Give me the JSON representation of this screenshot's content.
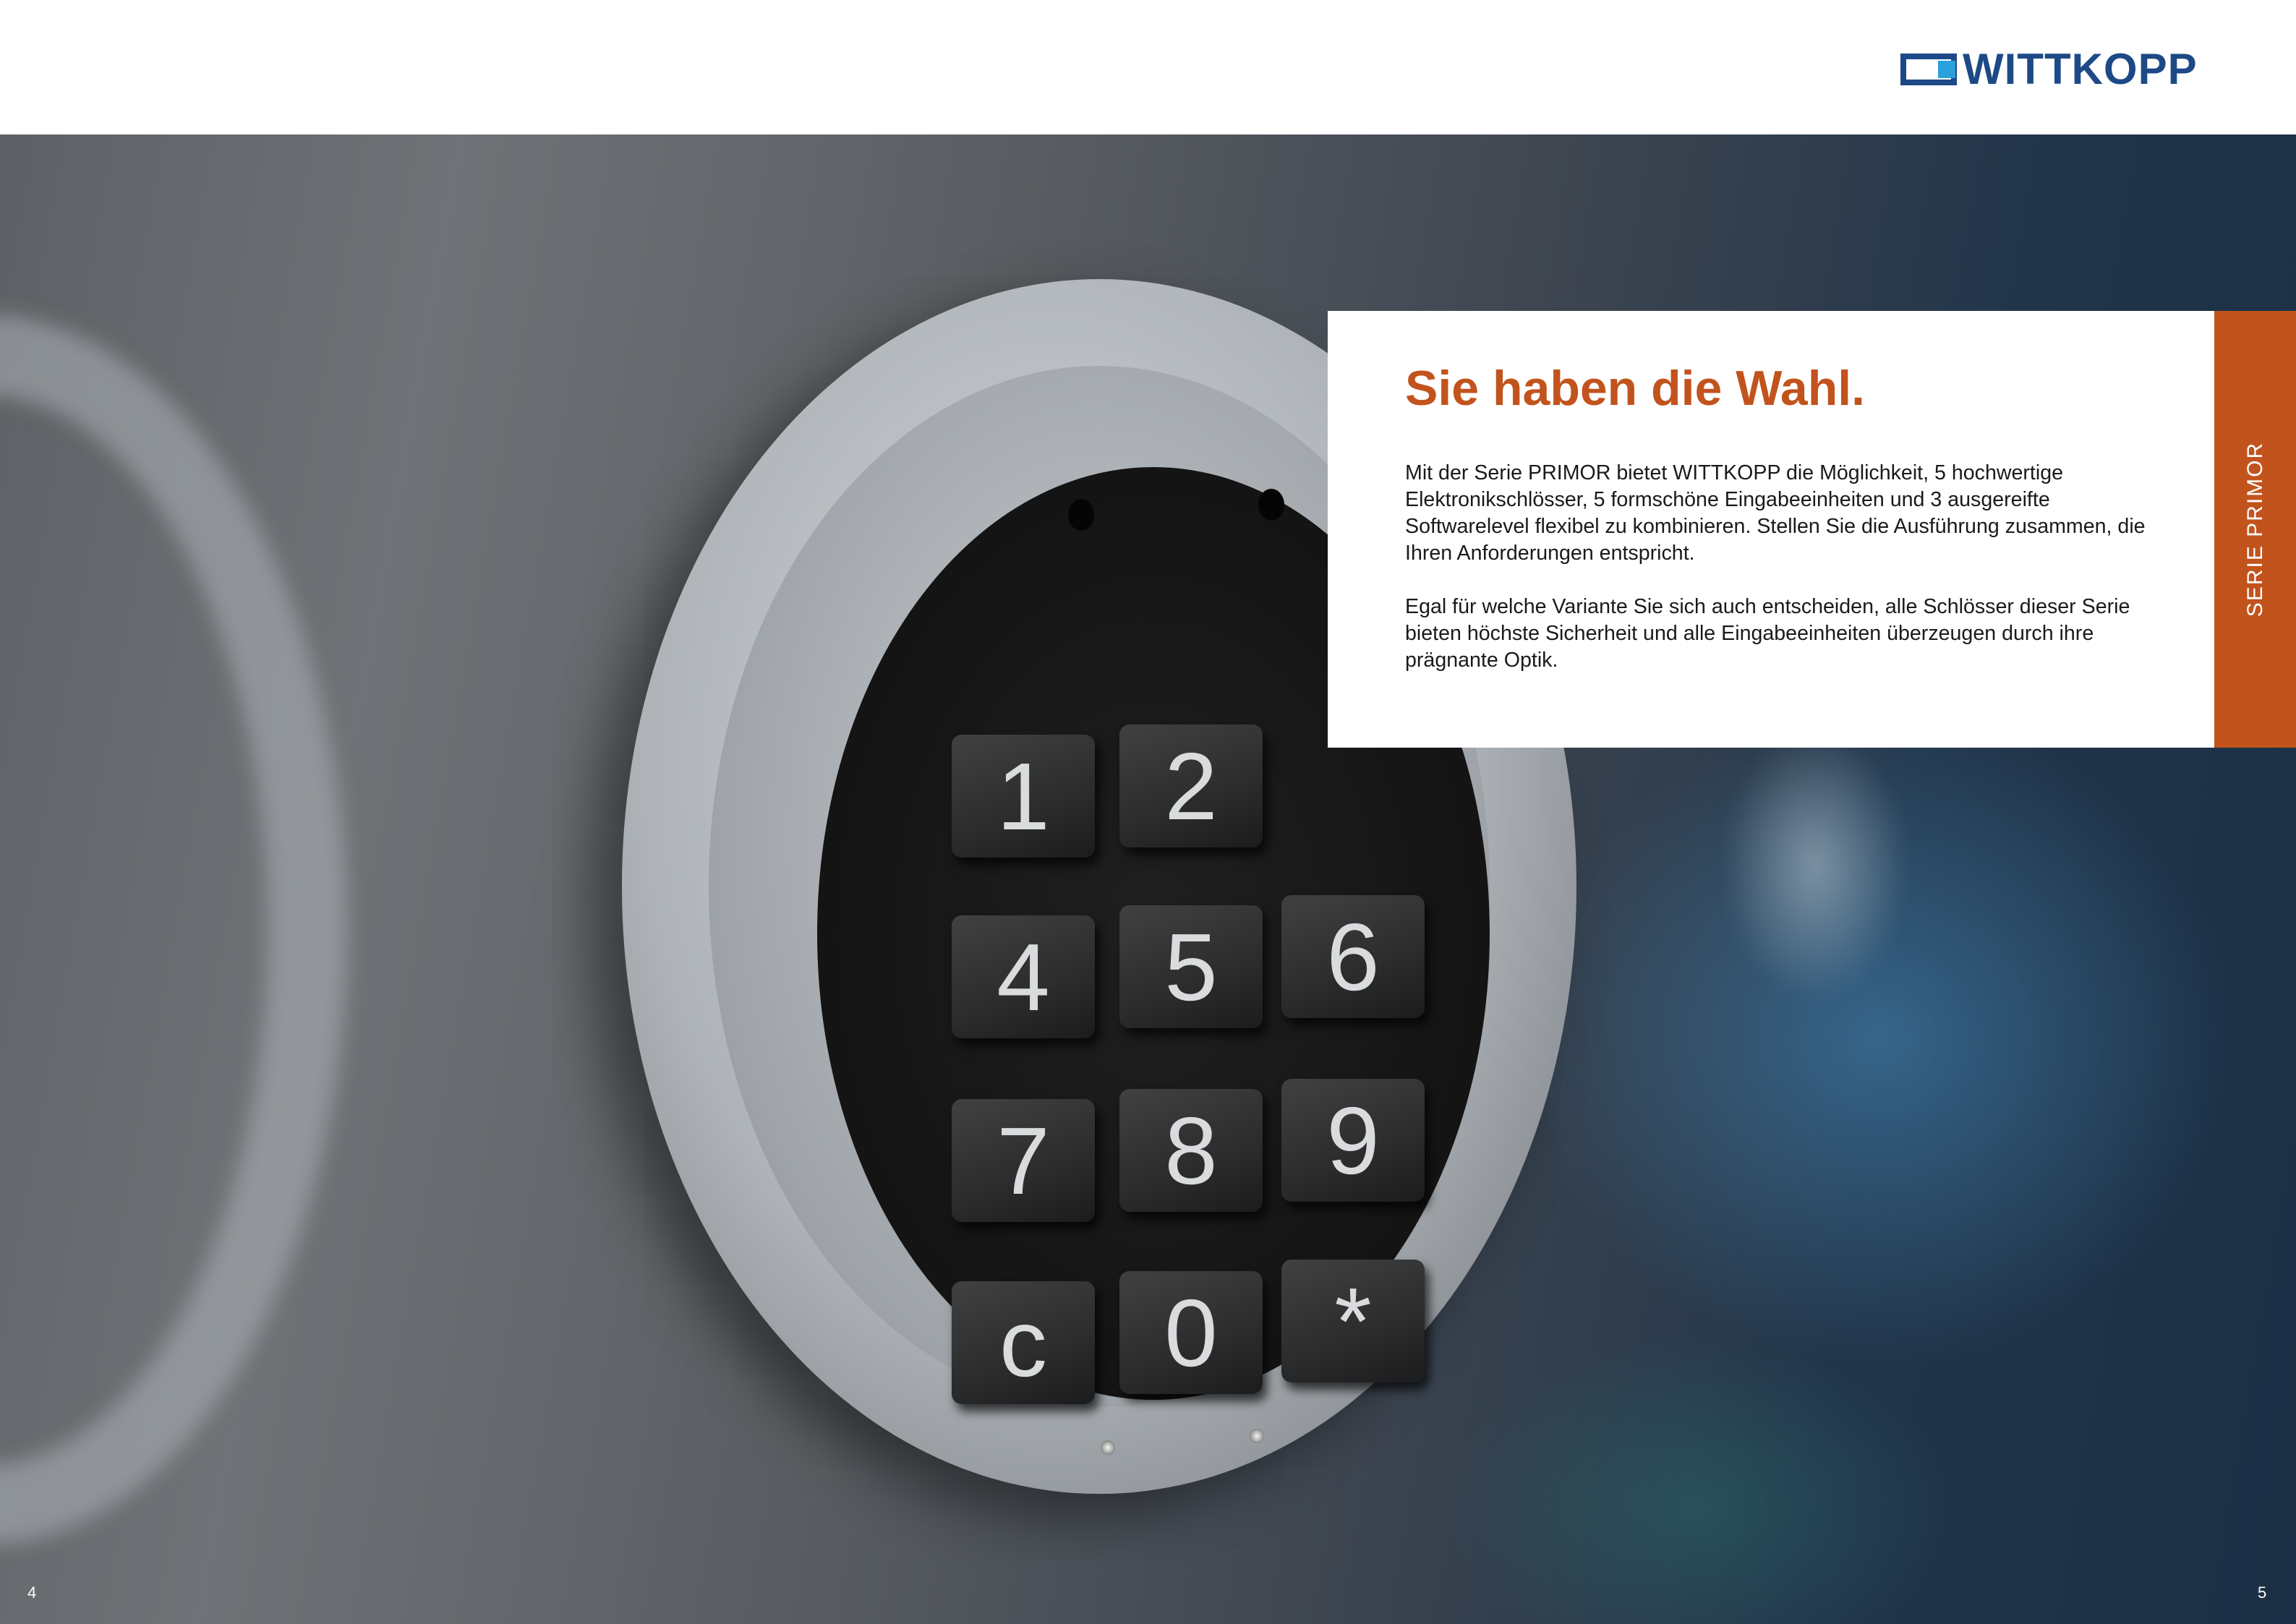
{
  "brand": {
    "logo_text": "WITTKOPP",
    "primary_color": "#1d4a86",
    "accent_color": "#2aa0dc"
  },
  "keypad": {
    "keys": [
      "1",
      "2",
      "4",
      "5",
      "6",
      "7",
      "8",
      "9",
      "c",
      "0",
      "*"
    ]
  },
  "panel": {
    "title": "Sie haben die Wahl.",
    "paragraph_1": "Mit der Serie PRIMOR bietet WITTKOPP die Möglichkeit, 5 hochwertige Elektronikschlösser, 5 formschöne Eingabeeinheiten und 3 ausgereifte Softwarelevel flexibel zu kombinieren. Stellen Sie die Ausführung zusammen, die Ihren Anforderungen entspricht.",
    "paragraph_2": "Egal für welche Variante Sie sich auch entscheiden, alle Schlösser dieser Serie bieten höchste Sicherheit und alle Eingabeeinheiten überzeugen durch ihre prägnante Optik.",
    "accent_color": "#c2531d"
  },
  "side_tab": {
    "label": "SERIE PRIMOR"
  },
  "footer": {
    "page_left": "4",
    "page_right": "5"
  }
}
